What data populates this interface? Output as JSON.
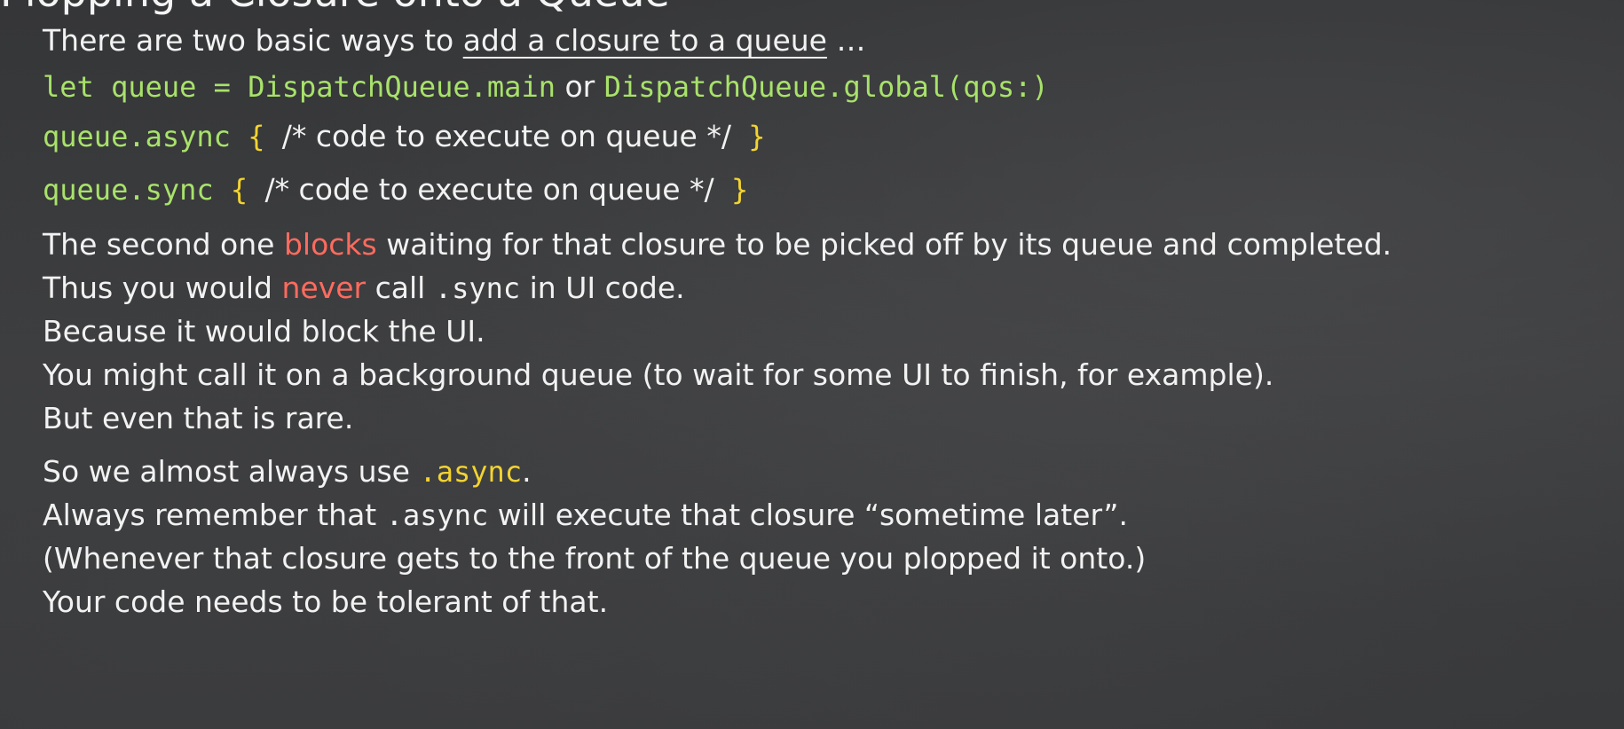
{
  "title": "Plopping a Closure onto a Queue",
  "intro": {
    "text": "There are two basic ways to ",
    "link": "add a closure to a queue",
    "suffix": " …"
  },
  "code_let": {
    "part1": "let queue = DispatchQueue.main",
    "or": " or ",
    "part2": "DispatchQueue.global(qos:)"
  },
  "code_async": {
    "call": "queue.async",
    "open": " { ",
    "comment": "/* code to execute on queue */",
    "close": " }"
  },
  "code_sync": {
    "call": "queue.sync",
    "open": " { ",
    "comment": "/* code to execute on queue */",
    "close": " }"
  },
  "para1": {
    "line1_a": "The second one ",
    "line1_red": "blocks",
    "line1_b": " waiting for that closure to be picked off by its queue and completed.",
    "line2_a": "Thus you would ",
    "line2_red": "never",
    "line2_b": " call ",
    "line2_code": ".sync",
    "line2_c": " in UI code.",
    "line3": "Because it would block the UI.",
    "line4": "You might call it on a background queue (to wait for some UI to finish, for example).",
    "line5": "But even that is rare."
  },
  "para2": {
    "line1_a": "So we almost always use ",
    "line1_code": ".async",
    "line1_b": ".",
    "line2_a": "Always remember that ",
    "line2_code": ".async",
    "line2_b": " will execute that closure “sometime later”.",
    "line3": "(Whenever that closure gets to the front of the queue you plopped it onto.)",
    "line4": "Your code needs to be tolerant of that."
  }
}
